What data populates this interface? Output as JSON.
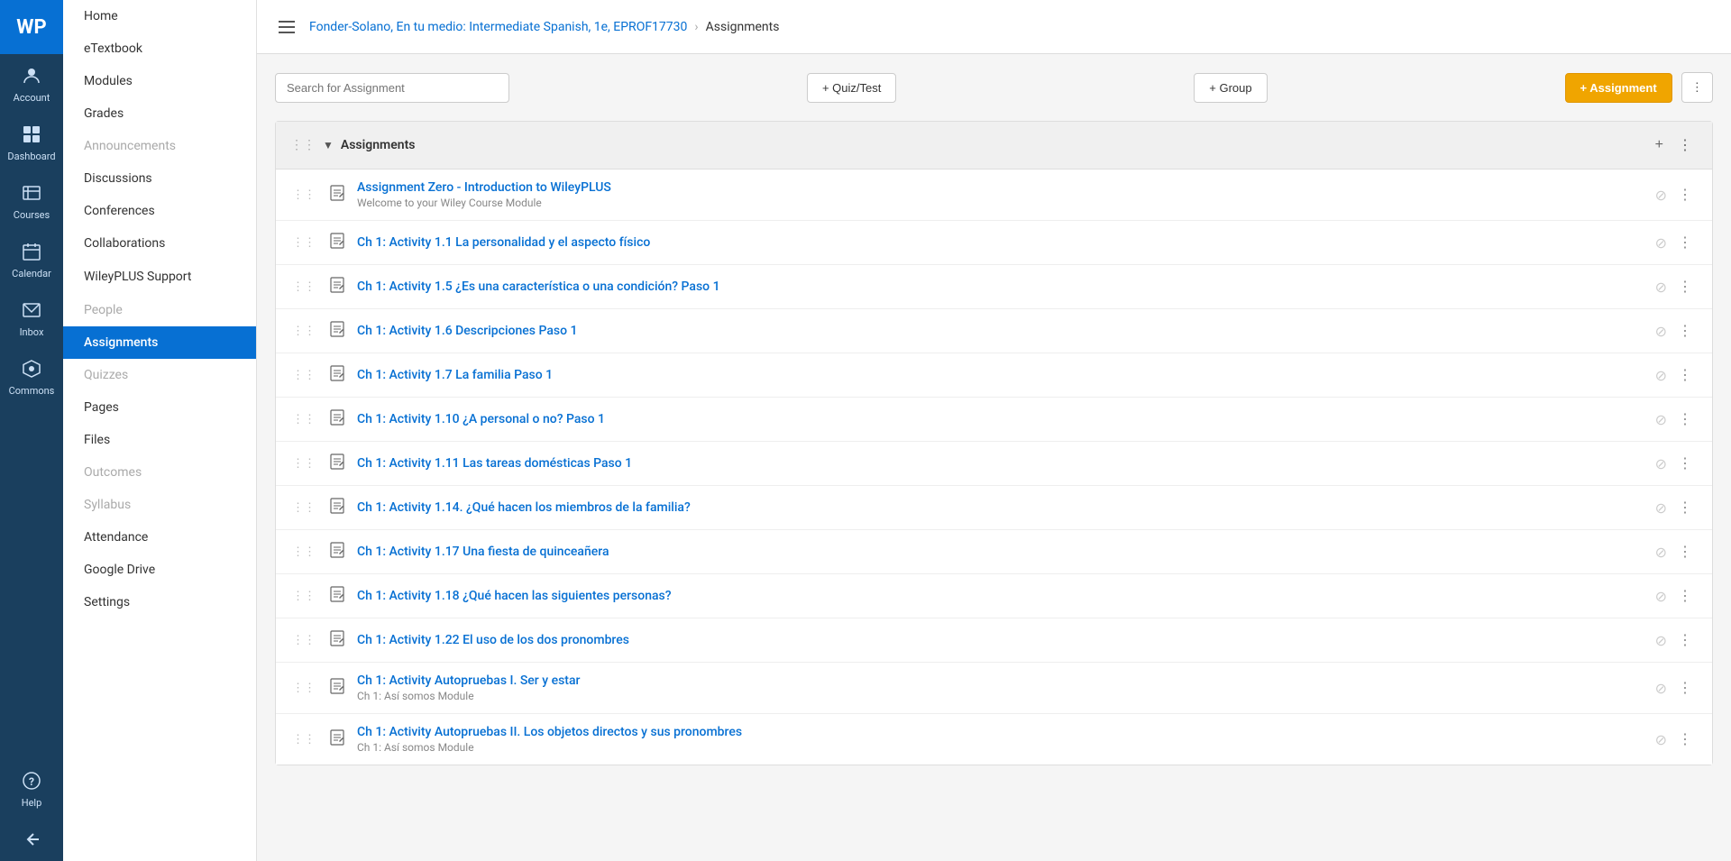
{
  "globalSidebar": {
    "logo": "WP",
    "items": [
      {
        "id": "account",
        "label": "Account",
        "icon": "👤"
      },
      {
        "id": "dashboard",
        "label": "Dashboard",
        "icon": "⊞"
      },
      {
        "id": "courses",
        "label": "Courses",
        "icon": "📚"
      },
      {
        "id": "calendar",
        "label": "Calendar",
        "icon": "📅"
      },
      {
        "id": "inbox",
        "label": "Inbox",
        "icon": "✉"
      },
      {
        "id": "commons",
        "label": "Commons",
        "icon": "⬡"
      },
      {
        "id": "help",
        "label": "Help",
        "icon": "?"
      }
    ],
    "bottomIcon": "←"
  },
  "courseSidebar": {
    "items": [
      {
        "id": "home",
        "label": "Home",
        "active": false,
        "disabled": false
      },
      {
        "id": "etextbook",
        "label": "eTextbook",
        "active": false,
        "disabled": false
      },
      {
        "id": "modules",
        "label": "Modules",
        "active": false,
        "disabled": false
      },
      {
        "id": "grades",
        "label": "Grades",
        "active": false,
        "disabled": false
      },
      {
        "id": "announcements",
        "label": "Announcements",
        "active": false,
        "disabled": true
      },
      {
        "id": "discussions",
        "label": "Discussions",
        "active": false,
        "disabled": false
      },
      {
        "id": "conferences",
        "label": "Conferences",
        "active": false,
        "disabled": false
      },
      {
        "id": "collaborations",
        "label": "Collaborations",
        "active": false,
        "disabled": false
      },
      {
        "id": "wileyplusSupport",
        "label": "WileyPLUS Support",
        "active": false,
        "disabled": false
      },
      {
        "id": "people",
        "label": "People",
        "active": false,
        "disabled": true
      },
      {
        "id": "assignments",
        "label": "Assignments",
        "active": true,
        "disabled": false
      },
      {
        "id": "quizzes",
        "label": "Quizzes",
        "active": false,
        "disabled": true
      },
      {
        "id": "pages",
        "label": "Pages",
        "active": false,
        "disabled": false
      },
      {
        "id": "files",
        "label": "Files",
        "active": false,
        "disabled": false
      },
      {
        "id": "outcomes",
        "label": "Outcomes",
        "active": false,
        "disabled": true
      },
      {
        "id": "syllabus",
        "label": "Syllabus",
        "active": false,
        "disabled": true
      },
      {
        "id": "attendance",
        "label": "Attendance",
        "active": false,
        "disabled": false
      },
      {
        "id": "googleDrive",
        "label": "Google Drive",
        "active": false,
        "disabled": false
      },
      {
        "id": "settings",
        "label": "Settings",
        "active": false,
        "disabled": false
      }
    ]
  },
  "breadcrumb": {
    "course": "Fonder-Solano, En tu medio: Intermediate Spanish, 1e, EPROF17730",
    "current": "Assignments"
  },
  "toolbar": {
    "searchPlaceholder": "Search for Assignment",
    "quizTestLabel": "+ Quiz/Test",
    "groupLabel": "+ Group",
    "assignmentLabel": "+ Assignment"
  },
  "section": {
    "title": "Assignments",
    "assignments": [
      {
        "id": 1,
        "name": "Assignment Zero - Introduction to WileyPLUS",
        "sub": "Welcome to your Wiley Course Module",
        "hasSub": true
      },
      {
        "id": 2,
        "name": "Ch 1: Activity 1.1 La personalidad y el aspecto físico",
        "sub": "",
        "hasSub": false
      },
      {
        "id": 3,
        "name": "Ch 1: Activity 1.5 ¿Es una característica o una condición? Paso 1",
        "sub": "",
        "hasSub": false
      },
      {
        "id": 4,
        "name": "Ch 1: Activity 1.6 Descripciones Paso 1",
        "sub": "",
        "hasSub": false
      },
      {
        "id": 5,
        "name": "Ch 1: Activity 1.7 La familia Paso 1",
        "sub": "",
        "hasSub": false
      },
      {
        "id": 6,
        "name": "Ch 1: Activity 1.10 ¿A personal o no? Paso 1",
        "sub": "",
        "hasSub": false
      },
      {
        "id": 7,
        "name": "Ch 1: Activity 1.11 Las tareas domésticas Paso 1",
        "sub": "",
        "hasSub": false
      },
      {
        "id": 8,
        "name": "Ch 1: Activity 1.14. ¿Qué hacen los miembros de la familia?",
        "sub": "",
        "hasSub": false
      },
      {
        "id": 9,
        "name": "Ch 1: Activity 1.17 Una fiesta de quinceañera",
        "sub": "",
        "hasSub": false
      },
      {
        "id": 10,
        "name": "Ch 1: Activity 1.18 ¿Qué hacen las siguientes personas?",
        "sub": "",
        "hasSub": false
      },
      {
        "id": 11,
        "name": "Ch 1: Activity 1.22 El uso de los dos pronombres",
        "sub": "",
        "hasSub": false
      },
      {
        "id": 12,
        "name": "Ch 1: Activity Autopruebas I. Ser y estar",
        "sub": "Ch 1: Así somos Module",
        "hasSub": true
      },
      {
        "id": 13,
        "name": "Ch 1: Activity Autopruebas II. Los objetos directos y sus pronombres",
        "sub": "Ch 1: Así somos Module",
        "hasSub": true
      }
    ]
  }
}
